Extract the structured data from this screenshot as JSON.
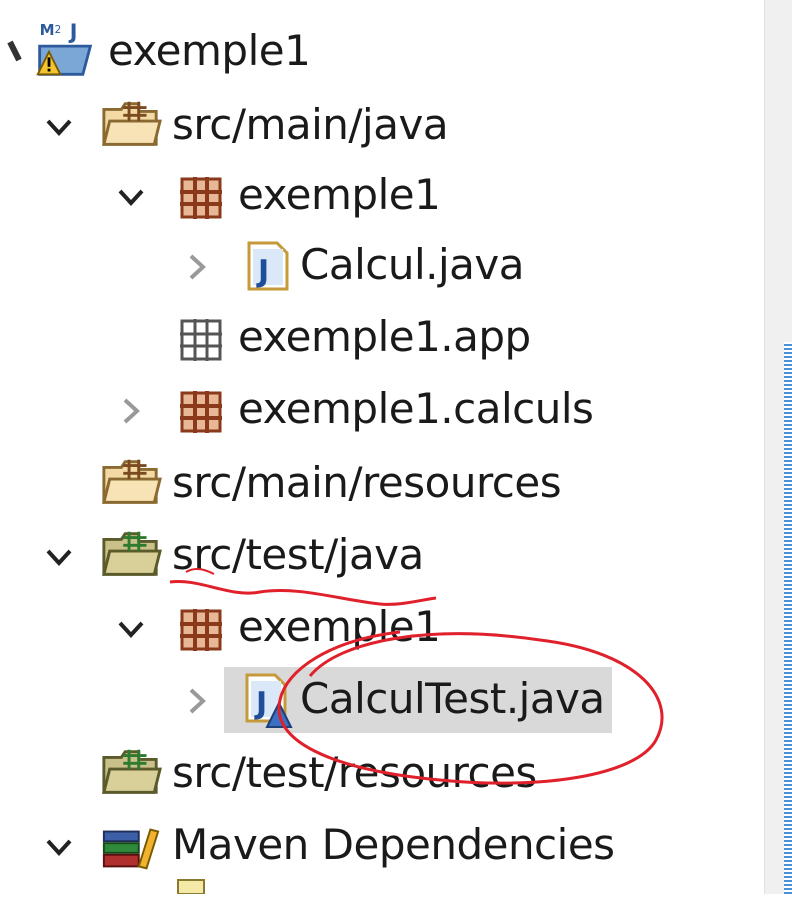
{
  "tree": {
    "items": [
      {
        "label": "exemple1",
        "icon": "maven-project-warning-icon",
        "expanded": true
      },
      {
        "label": "src/main/java",
        "icon": "source-folder-icon",
        "expanded": true
      },
      {
        "label": "exemple1",
        "icon": "package-icon",
        "expanded": true
      },
      {
        "label": "Calcul.java",
        "icon": "java-file-icon",
        "expanded": false
      },
      {
        "label": "exemple1.app",
        "icon": "empty-package-icon"
      },
      {
        "label": "exemple1.calculs",
        "icon": "package-icon",
        "expanded": false
      },
      {
        "label": "src/main/resources",
        "icon": "source-folder-icon"
      },
      {
        "label": "src/test/java",
        "icon": "test-source-folder-icon",
        "expanded": true
      },
      {
        "label": "exemple1",
        "icon": "package-icon",
        "expanded": true
      },
      {
        "label": "CalculTest.java",
        "icon": "java-test-file-icon",
        "expanded": false,
        "selected": true
      },
      {
        "label": "src/test/resources",
        "icon": "test-source-folder-icon"
      },
      {
        "label": "Maven Dependencies",
        "icon": "library-icon",
        "expanded": true
      }
    ]
  },
  "colors": {
    "annotation": "#e0202a",
    "selection": "#d9d9d9",
    "scroll_thumb": "#4a90d9"
  }
}
